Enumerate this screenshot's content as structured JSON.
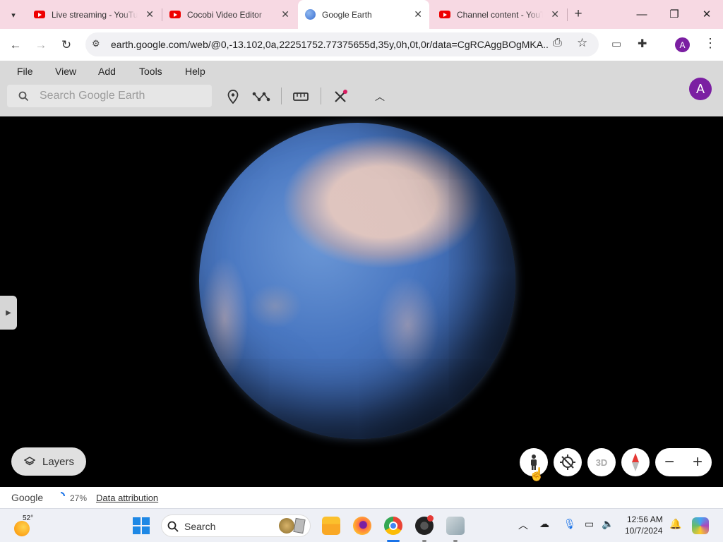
{
  "browser": {
    "tabs": [
      {
        "title": "Live streaming - YouTube",
        "icon": "youtube-icon",
        "active": false
      },
      {
        "title": "Cocobi Video Editor",
        "icon": "youtube-icon",
        "active": false
      },
      {
        "title": "Google Earth",
        "icon": "google-earth-icon",
        "active": true
      },
      {
        "title": "Channel content - YouTube",
        "icon": "youtube-icon",
        "active": false
      }
    ],
    "new_tab_glyph": "+",
    "url": "earth.google.com/web/@0,-13.102,0a,22251752.77375655d,35y,0h,0t,0r/data=CgRCAggBOgMKA...",
    "profile_initial": "A"
  },
  "app": {
    "menu": [
      "File",
      "View",
      "Add",
      "Tools",
      "Help"
    ],
    "search_placeholder": "Search Google Earth",
    "avatar_initial": "A",
    "layers_label": "Layers",
    "three_d_label": "3D",
    "zoom_out": "−",
    "zoom_in": "+",
    "status": {
      "google": "Google",
      "loading_percent": "27%",
      "attribution": "Data attribution"
    }
  },
  "taskbar": {
    "weather": "52°",
    "search_label": "Search",
    "time": "12:56 AM",
    "date": "10/7/2024"
  },
  "colors": {
    "tabstrip": "#f7d9e3",
    "avatar": "#7b1fa2",
    "appbar": "#d9d9d9"
  }
}
